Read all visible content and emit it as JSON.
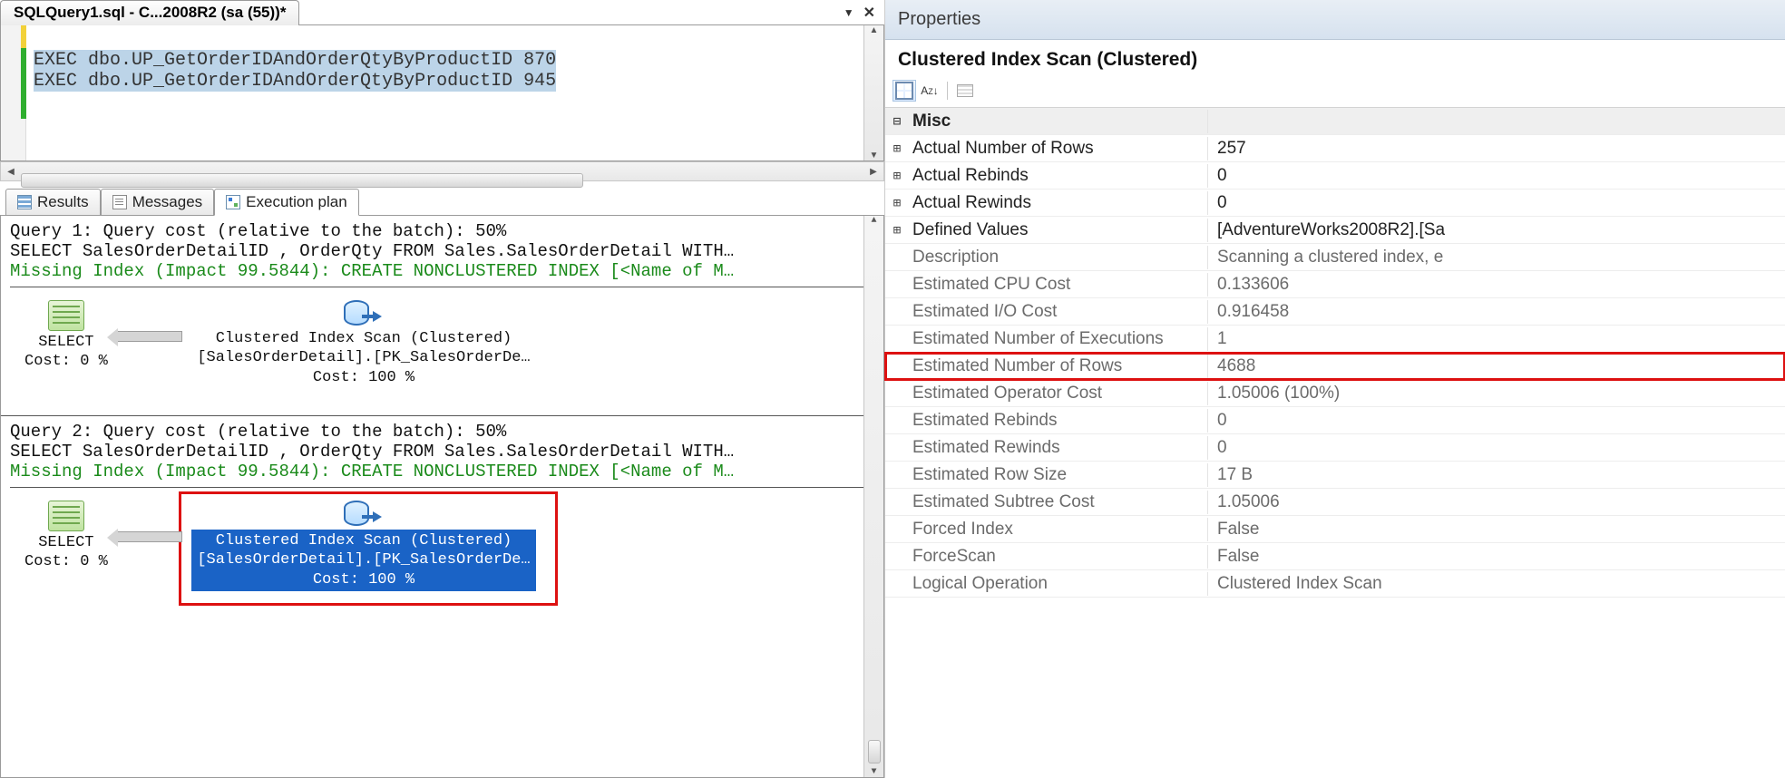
{
  "file_tab": {
    "title": "SQLQuery1.sql - C...2008R2 (sa (55))*"
  },
  "editor": {
    "line1": "EXEC dbo.UP_GetOrderIDAndOrderQtyByProductID 870",
    "line2": "EXEC dbo.UP_GetOrderIDAndOrderQtyByProductID 945"
  },
  "result_tabs": {
    "results": "Results",
    "messages": "Messages",
    "execplan": "Execution plan"
  },
  "plan": {
    "q1": {
      "header": "Query 1: Query cost (relative to the batch): 50%",
      "stmt": "SELECT SalesOrderDetailID , OrderQty FROM Sales.SalesOrderDetail WITH…",
      "missing": "Missing Index (Impact 99.5844): CREATE NONCLUSTERED INDEX [<Name of M…",
      "select_label": "SELECT",
      "select_cost": "Cost: 0 %",
      "scan_l1": "Clustered Index Scan (Clustered)",
      "scan_l2": "[SalesOrderDetail].[PK_SalesOrderDe…",
      "scan_l3": "Cost: 100 %"
    },
    "q2": {
      "header": "Query 2: Query cost (relative to the batch): 50%",
      "stmt": "SELECT SalesOrderDetailID , OrderQty FROM Sales.SalesOrderDetail WITH…",
      "missing": "Missing Index (Impact 99.5844): CREATE NONCLUSTERED INDEX [<Name of M…",
      "select_label": "SELECT",
      "select_cost": "Cost: 0 %",
      "scan_l1": "Clustered Index Scan (Clustered)",
      "scan_l2": "[SalesOrderDetail].[PK_SalesOrderDe…",
      "scan_l3": "Cost: 100 %"
    }
  },
  "properties": {
    "panel_title": "Properties",
    "object_title": "Clustered Index Scan (Clustered)",
    "sort_label": "A↓Z",
    "group": "Misc",
    "rows": [
      {
        "exp": "+",
        "k": "Actual Number of Rows",
        "v": "257",
        "ro": false
      },
      {
        "exp": "+",
        "k": "Actual Rebinds",
        "v": "0",
        "ro": false
      },
      {
        "exp": "+",
        "k": "Actual Rewinds",
        "v": "0",
        "ro": false
      },
      {
        "exp": "+",
        "k": "Defined Values",
        "v": "[AdventureWorks2008R2].[Sa",
        "ro": false
      },
      {
        "exp": "",
        "k": "Description",
        "v": "Scanning a clustered index, e",
        "ro": true
      },
      {
        "exp": "",
        "k": "Estimated CPU Cost",
        "v": "0.133606",
        "ro": true
      },
      {
        "exp": "",
        "k": "Estimated I/O Cost",
        "v": "0.916458",
        "ro": true
      },
      {
        "exp": "",
        "k": "Estimated Number of Executions",
        "v": "1",
        "ro": true
      },
      {
        "exp": "",
        "k": "Estimated Number of Rows",
        "v": "4688",
        "ro": true,
        "hl": true
      },
      {
        "exp": "",
        "k": "Estimated Operator Cost",
        "v": "1.05006 (100%)",
        "ro": true
      },
      {
        "exp": "",
        "k": "Estimated Rebinds",
        "v": "0",
        "ro": true
      },
      {
        "exp": "",
        "k": "Estimated Rewinds",
        "v": "0",
        "ro": true
      },
      {
        "exp": "",
        "k": "Estimated Row Size",
        "v": "17 B",
        "ro": true
      },
      {
        "exp": "",
        "k": "Estimated Subtree Cost",
        "v": "1.05006",
        "ro": true
      },
      {
        "exp": "",
        "k": "Forced Index",
        "v": "False",
        "ro": true
      },
      {
        "exp": "",
        "k": "ForceScan",
        "v": "False",
        "ro": true
      },
      {
        "exp": "",
        "k": "Logical Operation",
        "v": "Clustered Index Scan",
        "ro": true
      }
    ]
  }
}
